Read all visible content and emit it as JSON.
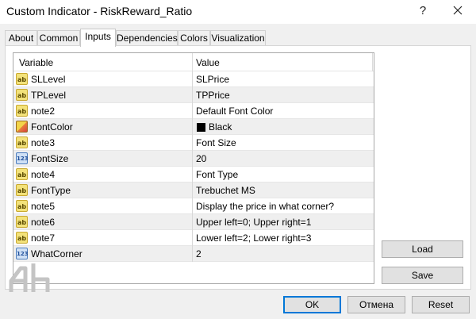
{
  "window": {
    "title": "Custom Indicator - RiskReward_Ratio",
    "help_label": "?"
  },
  "tabs": [
    {
      "label": "About"
    },
    {
      "label": "Common"
    },
    {
      "label": "Inputs"
    },
    {
      "label": "Dependencies"
    },
    {
      "label": "Colors"
    },
    {
      "label": "Visualization"
    }
  ],
  "active_tab": "Inputs",
  "grid": {
    "headers": {
      "variable": "Variable",
      "value": "Value"
    },
    "rows": [
      {
        "icon": "ab",
        "variable": "SLLevel",
        "value": "SLPrice"
      },
      {
        "icon": "ab",
        "variable": "TPLevel",
        "value": "TPPrice"
      },
      {
        "icon": "ab",
        "variable": "note2",
        "value": "Default Font Color"
      },
      {
        "icon": "color",
        "variable": "FontColor",
        "value": "Black"
      },
      {
        "icon": "ab",
        "variable": "note3",
        "value": "Font Size"
      },
      {
        "icon": "123",
        "variable": "FontSize",
        "value": "20"
      },
      {
        "icon": "ab",
        "variable": "note4",
        "value": "Font Type"
      },
      {
        "icon": "ab",
        "variable": "FontType",
        "value": "Trebuchet MS"
      },
      {
        "icon": "ab",
        "variable": "note5",
        "value": "Display the price in what corner?"
      },
      {
        "icon": "ab",
        "variable": "note6",
        "value": "Upper left=0; Upper right=1"
      },
      {
        "icon": "ab",
        "variable": "note7",
        "value": "Lower left=2; Lower right=3"
      },
      {
        "icon": "123",
        "variable": "WhatCorner",
        "value": "2"
      }
    ],
    "font_color_swatch": "#000000"
  },
  "side_buttons": {
    "load": "Load",
    "save": "Save"
  },
  "footer_buttons": {
    "ok": "OK",
    "cancel": "Отмена",
    "reset": "Reset"
  },
  "colors": {
    "accent": "#0078d7",
    "window_bg": "#f0f0f0",
    "alt_row": "#efefef"
  }
}
